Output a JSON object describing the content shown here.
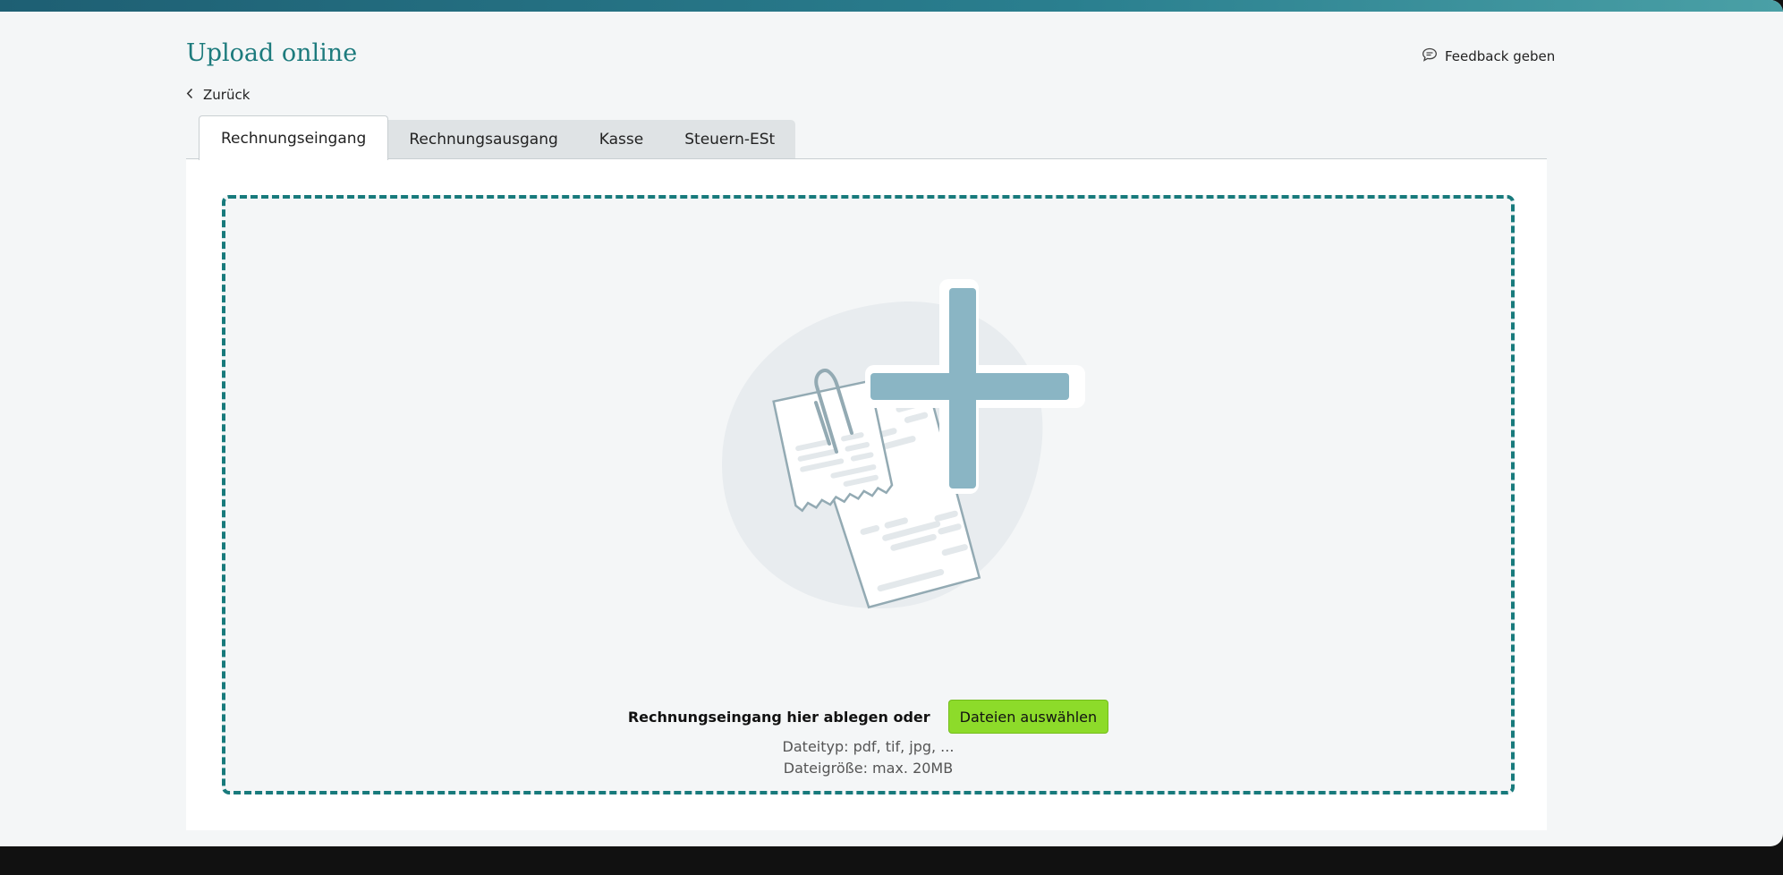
{
  "header": {
    "title": "Upload online",
    "feedback_label": "Feedback geben",
    "back_label": "Zurück"
  },
  "tabs": [
    {
      "label": "Rechnungseingang",
      "active": true
    },
    {
      "label": "Rechnungsausgang",
      "active": false
    },
    {
      "label": "Kasse",
      "active": false
    },
    {
      "label": "Steuern-ESt",
      "active": false
    }
  ],
  "dropzone": {
    "drop_text": "Rechnungseingang hier ablegen oder",
    "select_button": "Dateien auswählen",
    "file_types": "Dateityp: pdf, tif, jpg, ...",
    "file_size": "Dateigröße: max. 20MB"
  },
  "colors": {
    "accent": "#1d7b7d",
    "dash_border": "#187a7c",
    "button": "#8ddb2a",
    "icon_blue": "#8ab5c4",
    "top_bar": "#1e5f73"
  },
  "icons": [
    "speech-bubble-icon",
    "chevron-left-icon",
    "upload-documents-illustration",
    "plus-icon",
    "paperclip-icon"
  ]
}
